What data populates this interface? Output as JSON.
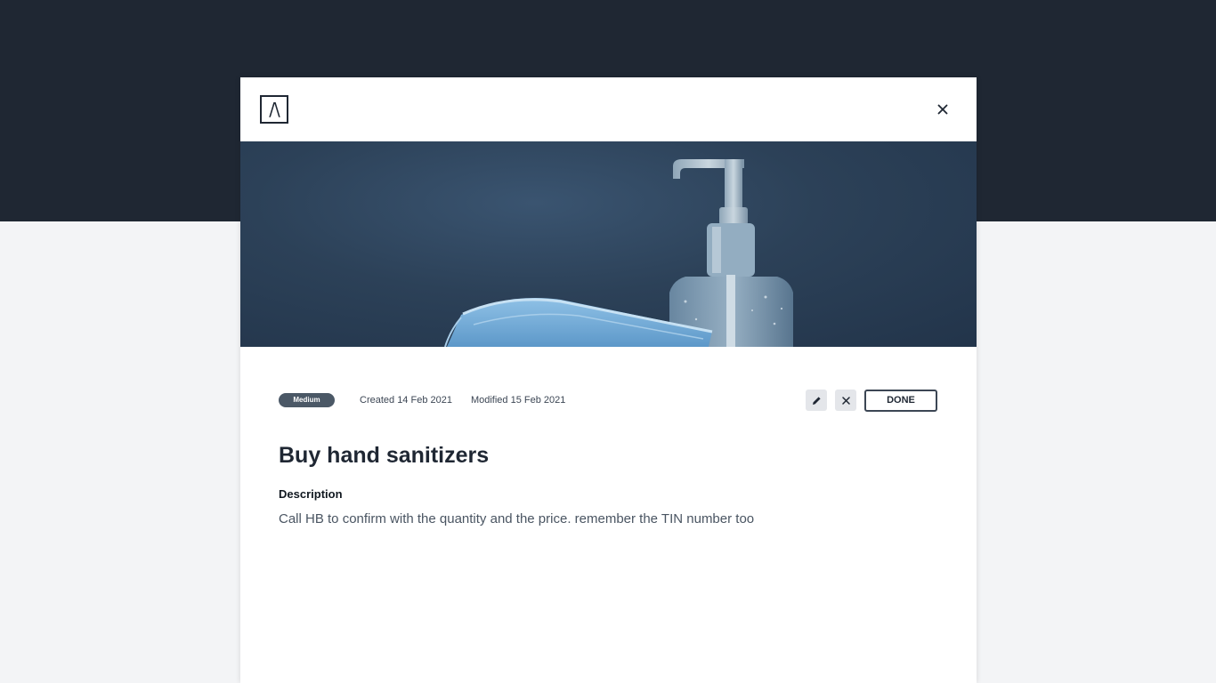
{
  "header": {
    "logo_text": "/\\",
    "close_icon": "close-icon"
  },
  "banner": {
    "subject": "hand sanitizer bottle and surgical mask"
  },
  "task": {
    "priority": "Medium",
    "created": "Created 14 Feb 2021",
    "modified": "Modified 15 Feb 2021",
    "title": "Buy hand sanitizers",
    "description_label": "Description",
    "description": "Call HB to confirm with the quantity and the price. remember the TIN number too"
  },
  "actions": {
    "edit_icon": "pencil-icon",
    "delete_icon": "close-icon",
    "done_label": "DONE"
  },
  "colors": {
    "top_band": "#1f2733",
    "page_bg": "#f3f4f6",
    "badge_bg": "#4b5866",
    "title": "#1f2733"
  }
}
